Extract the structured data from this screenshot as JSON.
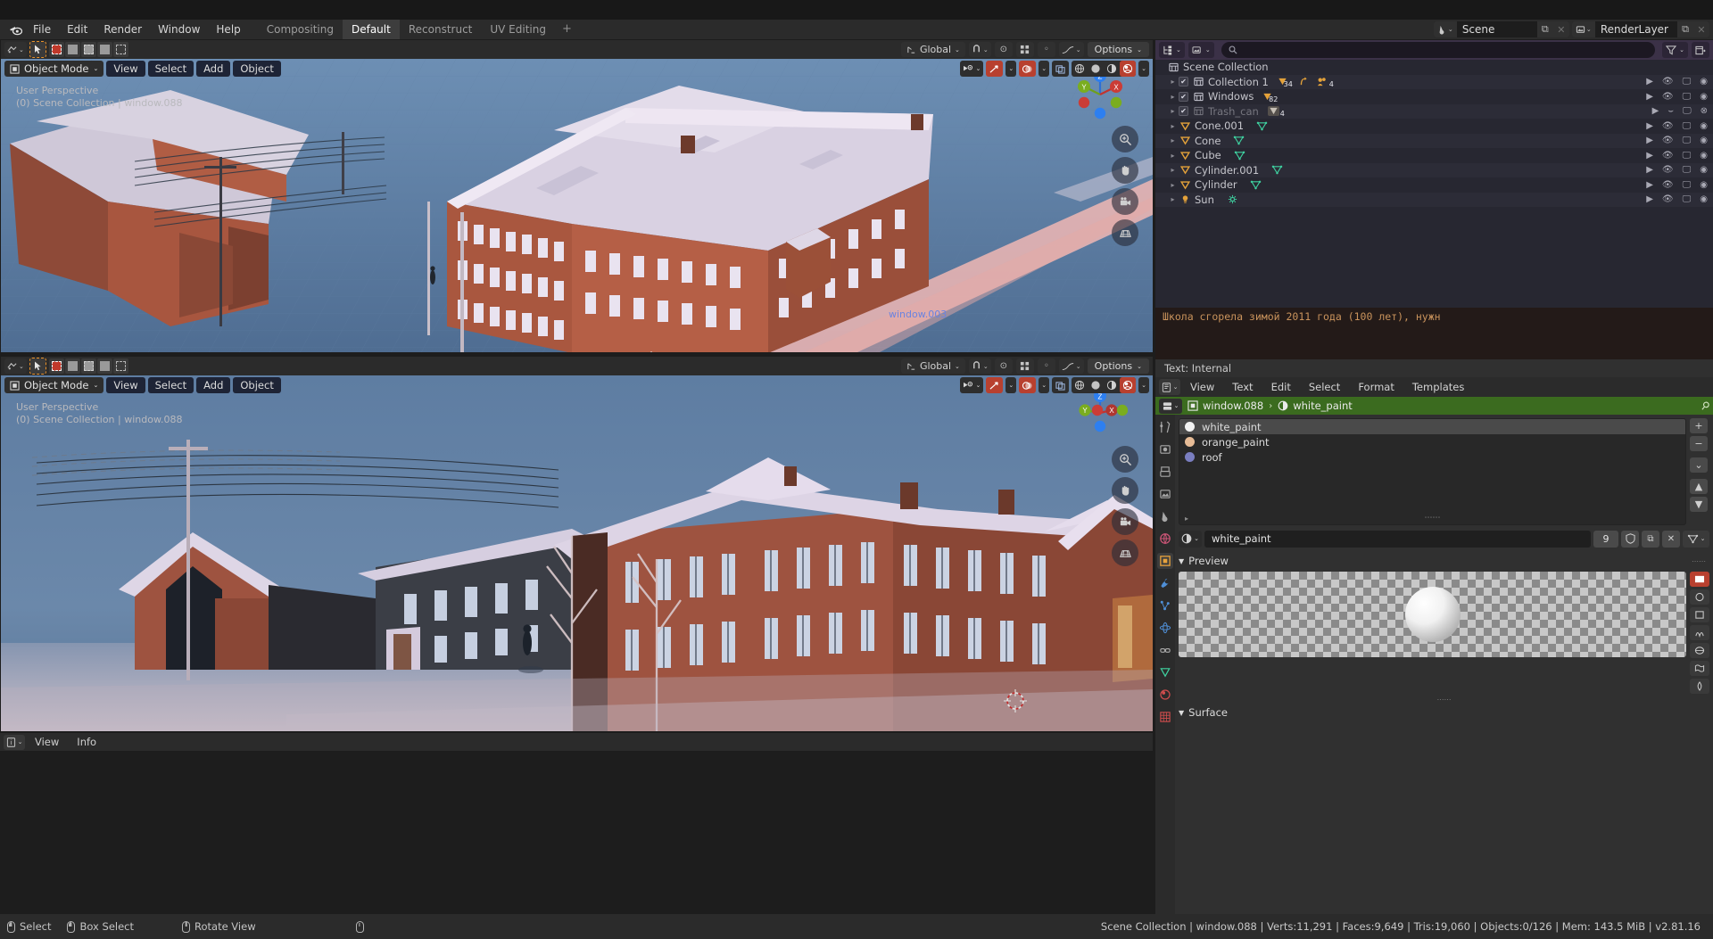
{
  "app": {
    "name": "Blender",
    "version_status": "v2.81.16"
  },
  "topbar": {
    "menus": [
      "File",
      "Edit",
      "Render",
      "Window",
      "Help"
    ],
    "workspaces": [
      {
        "label": "Compositing",
        "active": false
      },
      {
        "label": "Default",
        "active": true
      },
      {
        "label": "Reconstruct",
        "active": false
      },
      {
        "label": "UV Editing",
        "active": false
      }
    ],
    "add_workspace": "+",
    "scene_field": {
      "icon": "scene-icon",
      "value": "Scene",
      "new_btn": "copy-icon",
      "unlink_btn": "x-icon"
    },
    "viewlayer_field": {
      "icon": "viewlayer-icon",
      "value": "RenderLayer",
      "new_btn": "copy-icon",
      "unlink_btn": "x-icon"
    }
  },
  "viewport_top": {
    "tool_header": {
      "editor_type": "editor-type-icon",
      "active_tool": "tweak-tool",
      "select_modes": [
        "set",
        "extend",
        "subtract",
        "invert",
        "intersect"
      ],
      "transform_orientation": "Global",
      "snap": "snap-magnet",
      "proportional": "proportional-edit",
      "options_label": "Options"
    },
    "mode": "Object Mode",
    "menus": [
      "View",
      "Select",
      "Add",
      "Object"
    ],
    "overlay_text_line1": "User Perspective",
    "overlay_text_line2": "(0) Scene Collection | window.088",
    "gizmo_axes": {
      "x": "X",
      "y": "Y",
      "z": "Z"
    },
    "nav_buttons": [
      "zoom-icon",
      "pan-hand-icon",
      "camera-icon",
      "grid-icon"
    ],
    "shading_modes": [
      "wireframe",
      "solid",
      "material-preview",
      "rendered"
    ],
    "shading_active": "rendered",
    "scene_object_label": "window.003"
  },
  "viewport_bottom": {
    "tool_header": {
      "editor_type": "editor-type-icon",
      "active_tool": "tweak-tool",
      "transform_orientation": "Global",
      "options_label": "Options"
    },
    "mode": "Object Mode",
    "menus": [
      "View",
      "Select",
      "Add",
      "Object"
    ],
    "overlay_text_line1": "User Perspective",
    "overlay_text_line2": "(0) Scene Collection | window.088",
    "gizmo_axes": {
      "x": "X",
      "y": "Y",
      "z": "Z"
    },
    "shading_active": "rendered"
  },
  "outliner": {
    "display_mode": "View Layer",
    "search_placeholder": "",
    "filter_icon": "filter-icon",
    "new_collection_icon": "new-collection-icon",
    "root": "Scene Collection",
    "rows": [
      {
        "name": "Collection 1",
        "type": "collection",
        "indent": 1,
        "checkbox": true,
        "badges": [
          {
            "icon": "mesh-data",
            "count": "34"
          },
          {
            "icon": "modifier",
            "count": ""
          },
          {
            "icon": "camera-group",
            "count": "4"
          }
        ],
        "disabled": false
      },
      {
        "name": "Windows",
        "type": "collection",
        "indent": 1,
        "checkbox": true,
        "badges": [
          {
            "icon": "mesh-data",
            "count": "82"
          }
        ],
        "disabled": false
      },
      {
        "name": "Trash_can",
        "type": "collection",
        "indent": 1,
        "checkbox": true,
        "badges": [
          {
            "icon": "mesh-data",
            "count": "4"
          }
        ],
        "disabled": true
      },
      {
        "name": "Cone.001",
        "type": "mesh",
        "indent": 1,
        "checkbox": false,
        "badges": [
          {
            "icon": "mesh-tri",
            "count": ""
          }
        ],
        "disabled": false
      },
      {
        "name": "Cone",
        "type": "mesh",
        "indent": 1,
        "checkbox": false,
        "badges": [
          {
            "icon": "mesh-tri",
            "count": ""
          }
        ],
        "disabled": false
      },
      {
        "name": "Cube",
        "type": "mesh",
        "indent": 1,
        "checkbox": false,
        "badges": [
          {
            "icon": "mesh-tri",
            "count": ""
          }
        ],
        "disabled": false
      },
      {
        "name": "Cylinder.001",
        "type": "mesh",
        "indent": 1,
        "checkbox": false,
        "badges": [
          {
            "icon": "mesh-tri",
            "count": ""
          }
        ],
        "disabled": false
      },
      {
        "name": "Cylinder",
        "type": "mesh",
        "indent": 1,
        "checkbox": false,
        "badges": [
          {
            "icon": "mesh-tri",
            "count": ""
          }
        ],
        "disabled": false
      },
      {
        "name": "Sun",
        "type": "light",
        "indent": 1,
        "checkbox": false,
        "badges": [
          {
            "icon": "light-data",
            "count": ""
          }
        ],
        "disabled": false
      }
    ],
    "console_line": "Школа сгорела зимой 2011 года (100 лет), нужн"
  },
  "text_editor": {
    "title": "Text: Internal",
    "menus": [
      "View",
      "Text",
      "Edit",
      "Select",
      "Format",
      "Templates"
    ],
    "editor_icon": "text-editor-icon"
  },
  "properties": {
    "breadcrumb": {
      "editor_icon": "properties-icon",
      "object_icon": "object-icon",
      "object": "window.088",
      "separator": "›",
      "material_icon": "material-icon",
      "material": "white_paint",
      "pin_icon": "pin-icon"
    },
    "tabs": [
      {
        "name": "tool",
        "icon": "tool-icon",
        "active": false
      },
      {
        "name": "render",
        "icon": "render-icon",
        "active": false
      },
      {
        "name": "output",
        "icon": "output-icon",
        "active": false
      },
      {
        "name": "view-layer",
        "icon": "view-layer-icon",
        "active": false
      },
      {
        "name": "scene",
        "icon": "scene-icon",
        "active": false
      },
      {
        "name": "world",
        "icon": "world-icon",
        "active": false
      },
      {
        "name": "object",
        "icon": "object-icon",
        "active": true
      },
      {
        "name": "modifier",
        "icon": "wrench-icon",
        "active": false
      },
      {
        "name": "particles",
        "icon": "particles-icon",
        "active": false
      },
      {
        "name": "physics",
        "icon": "physics-icon",
        "active": false
      },
      {
        "name": "constraints",
        "icon": "constraints-icon",
        "active": false
      },
      {
        "name": "data",
        "icon": "data-icon",
        "active": false
      },
      {
        "name": "material",
        "icon": "material-icon",
        "active": false
      },
      {
        "name": "texture",
        "icon": "texture-icon",
        "active": false
      }
    ],
    "material_slots": [
      {
        "name": "white_paint",
        "color": "#f2f2f2",
        "selected": true
      },
      {
        "name": "orange_paint",
        "color": "#e6bb96",
        "selected": false
      },
      {
        "name": "roof",
        "color": "#7a7ec0",
        "selected": false
      }
    ],
    "slot_side_buttons": [
      "+",
      "−",
      "⌄",
      "▲",
      "▼"
    ],
    "material_id": {
      "icon": "material-icon",
      "name": "white_paint",
      "users": "9",
      "fake_user_icon": "shield-icon",
      "new_icon": "copy-icon",
      "unlink_icon": "x-icon",
      "browse_icon": "node-icon"
    },
    "preview_panel": {
      "label": "Preview",
      "render_types": [
        "flat",
        "sphere",
        "cube",
        "hair",
        "shader-ball",
        "cloth",
        "fluid"
      ],
      "active_render_type": "flat"
    },
    "surface_panel": {
      "label": "Surface"
    }
  },
  "info_editor": {
    "editor_icon": "info-icon",
    "menus": [
      "View",
      "Info"
    ]
  },
  "statusbar": {
    "keymap": [
      {
        "mouse": "lmb",
        "label": "Select"
      },
      {
        "mouse": "lmb-drag",
        "label": "Box Select"
      },
      {
        "mouse": "mmb",
        "label": "Rotate View"
      },
      {
        "mouse": "rmb",
        "label": ""
      }
    ],
    "stats": "Scene Collection | window.088 | Verts:11,291 | Faces:9,649 | Tris:19,060 | Objects:0/126 | Mem: 143.5 MiB | v2.81.16"
  },
  "colors": {
    "accent_orange": "#e8912a",
    "accent_red": "#b8402f",
    "outliner_header": "#3b3147",
    "breadcrumb_green": "#3b6b1f",
    "sky_blue": "#5b7fa6",
    "brick": "#a0533d"
  }
}
